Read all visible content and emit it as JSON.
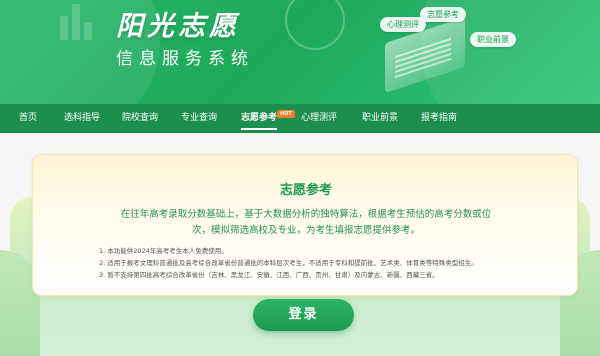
{
  "banner": {
    "title": "阳光志愿",
    "subtitle": "信息服务系统",
    "tags": [
      "志愿参考",
      "心理测评",
      "职业前景"
    ]
  },
  "nav": {
    "items": [
      {
        "label": "首页"
      },
      {
        "label": "选科指导"
      },
      {
        "label": "院校查询"
      },
      {
        "label": "专业查询"
      },
      {
        "label": "志愿参考",
        "badge": "HOT",
        "active": true
      },
      {
        "label": "心理测评"
      },
      {
        "label": "职业前景"
      },
      {
        "label": "报考指南"
      }
    ]
  },
  "card": {
    "title": "志愿参考",
    "description": "在往年高考录取分数基础上，基于大数据分析的独特算法，根据考生预估的高考分数或位次，模拟筛选高校及专业，为考生填报志愿提供参考。",
    "notes": [
      "1. 本功能供2024年高考考生本人免费使用。",
      "2. 适用于报考文理科普通批及高考综合改革省份普通批的本科层次考生，不适用于专科和提前批、艺术类、体育类等特殊类型招生。",
      "3. 暂不支持第四批高考综合改革省份（吉林、黑龙江、安徽、江西、广西、贵州、甘肃）及内蒙古、新疆、西藏三省。"
    ]
  },
  "login": {
    "label": "登录"
  },
  "colors": {
    "brand_green": "#1fa85c",
    "nav_green": "#1c8f4c",
    "hot_orange": "#ff7a2e"
  }
}
